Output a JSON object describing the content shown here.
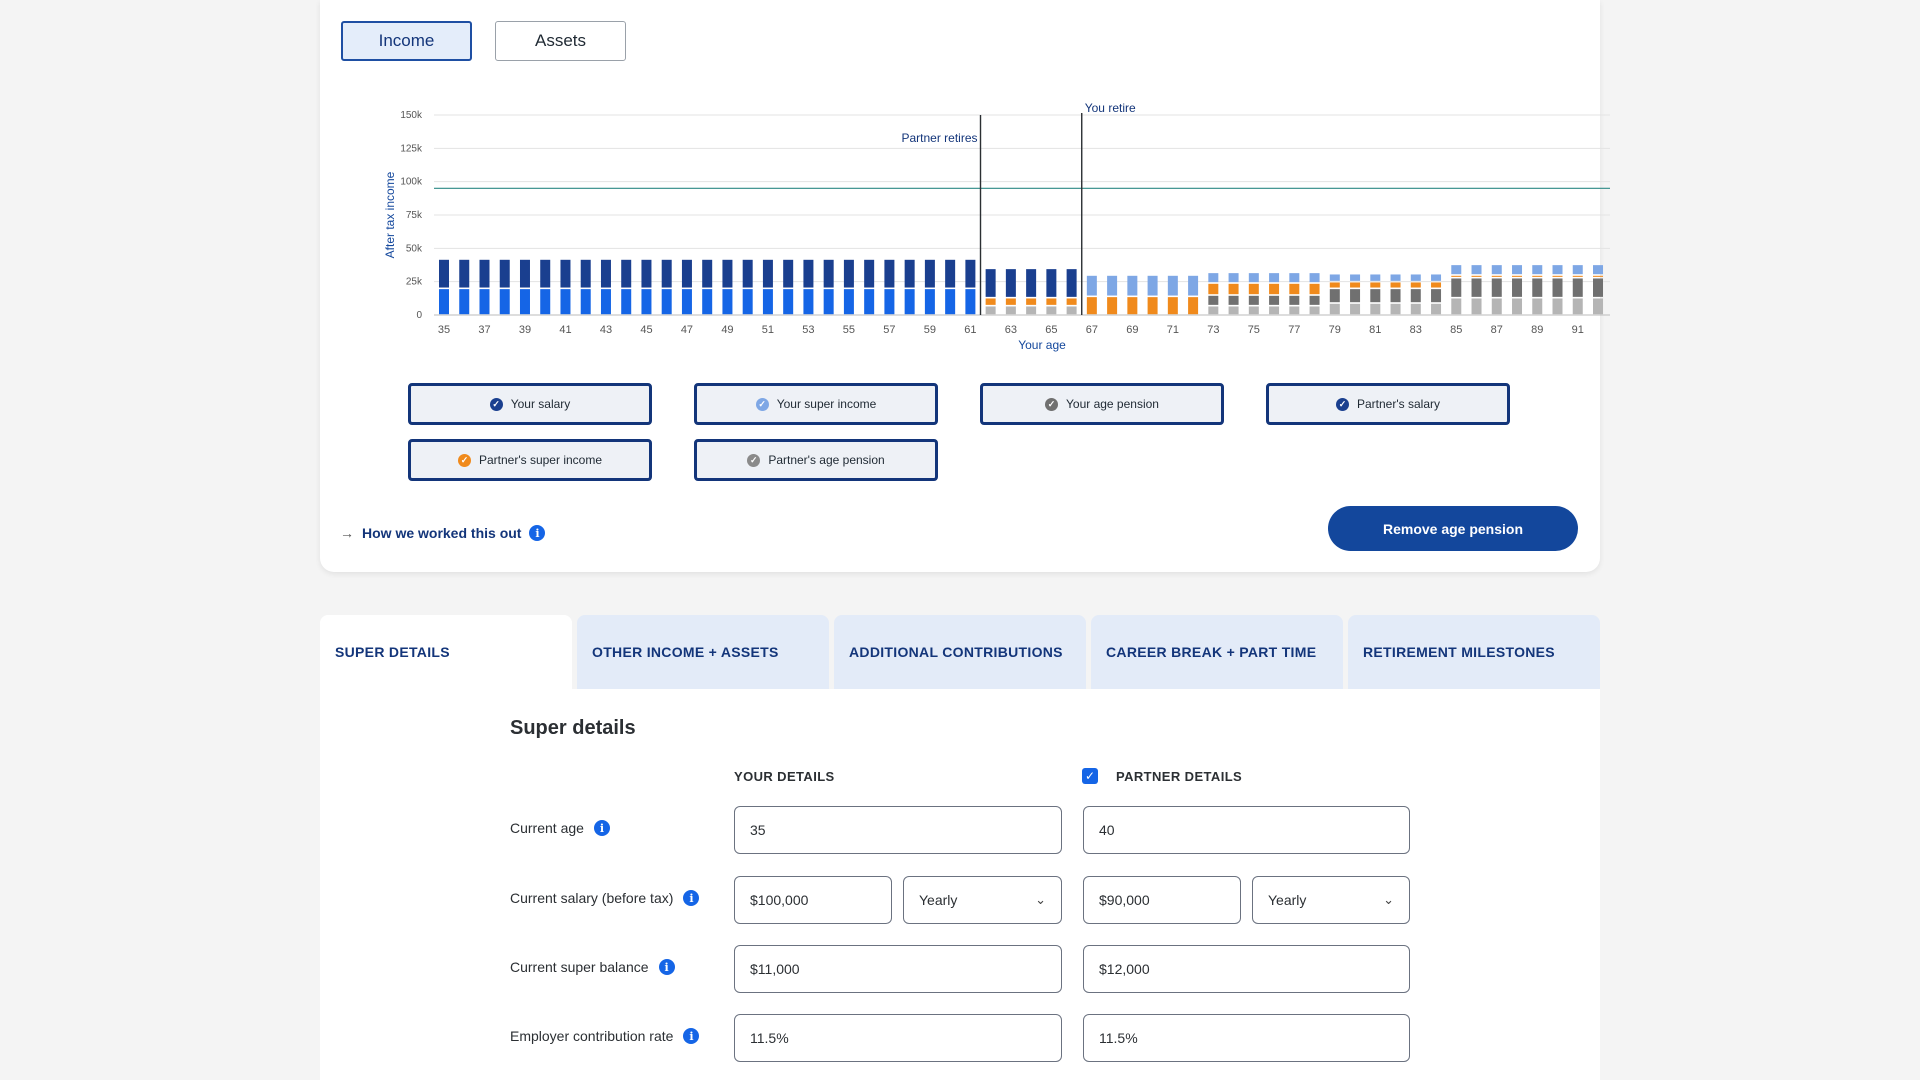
{
  "view_toggle": {
    "income_label": "Income",
    "assets_label": "Assets",
    "active": "income"
  },
  "chart_data": {
    "type": "bar",
    "stacked": true,
    "ylabel": "After tax income",
    "xlabel": "Your age",
    "yticks": [
      "0",
      "25k",
      "50k",
      "75k",
      "100k",
      "125k",
      "150k"
    ],
    "ylim": [
      0,
      150000
    ],
    "x_tick_labels": [
      "35",
      "37",
      "39",
      "41",
      "43",
      "45",
      "47",
      "49",
      "51",
      "53",
      "55",
      "57",
      "59",
      "61",
      "63",
      "65",
      "67",
      "69",
      "71",
      "73",
      "75",
      "77",
      "79",
      "81",
      "83",
      "85",
      "87",
      "89",
      "91"
    ],
    "reference_line_value": 95000,
    "markers": [
      {
        "label": "Partner retires",
        "age": 62
      },
      {
        "label": "You retire",
        "age": 67
      }
    ],
    "colors": {
      "your_salary": "#1a3f8f",
      "partner_salary": "#1565e6",
      "your_super_income": "#7ea7e5",
      "partner_super_income": "#f08a1c",
      "your_age_pension": "#707070",
      "partner_age_pension": "#b5b5b5",
      "reference_line": "#2d8a86"
    },
    "segments": [
      {
        "from_age": 35,
        "to_age": 61,
        "values": {
          "partner_salary": 20000,
          "your_salary": 22000
        }
      },
      {
        "from_age": 62,
        "to_age": 66,
        "values": {
          "partner_age_pension": 7000,
          "partner_super_income": 6000,
          "your_salary": 22000
        }
      },
      {
        "from_age": 67,
        "to_age": 67,
        "values": {
          "partner_super_income": 14000,
          "your_super_income": 16000
        }
      },
      {
        "from_age": 68,
        "to_age": 72,
        "values": {
          "partner_super_income": 14000,
          "your_super_income": 16000
        }
      },
      {
        "from_age": 73,
        "to_age": 78,
        "values": {
          "partner_age_pension": 7000,
          "partner_super_income": 9000,
          "your_age_pension": 8000,
          "your_super_income": 8000
        }
      },
      {
        "from_age": 79,
        "to_age": 84,
        "values": {
          "partner_age_pension": 9000,
          "partner_super_income": 5000,
          "your_age_pension": 11000,
          "your_super_income": 6000
        }
      },
      {
        "from_age": 85,
        "to_age": 92,
        "values": {
          "partner_age_pension": 13000,
          "partner_super_income": 2000,
          "your_age_pension": 15000,
          "your_super_income": 8000
        }
      }
    ]
  },
  "legend": [
    {
      "label": "Your salary",
      "color": "#1a3f8f"
    },
    {
      "label": "Your super income",
      "color": "#7ea7e5"
    },
    {
      "label": "Your age pension",
      "color": "#707070"
    },
    {
      "label": "Partner's salary",
      "color": "#1a3f8f"
    },
    {
      "label": "Partner's super income",
      "color": "#f08a1c"
    },
    {
      "label": "Partner's age pension",
      "color": "#8a8a8a"
    }
  ],
  "how_link": "How we worked this out",
  "remove_button": "Remove age pension",
  "tabs": [
    "SUPER DETAILS",
    "OTHER INCOME + ASSETS",
    "ADDITIONAL CONTRIBUTIONS",
    "CAREER BREAK + PART TIME",
    "RETIREMENT MILESTONES"
  ],
  "form": {
    "title": "Super details",
    "your_details": "YOUR DETAILS",
    "partner_details": "PARTNER DETAILS",
    "rows": {
      "age_label": "Current age",
      "salary_label": "Current salary (before tax)",
      "balance_label": "Current super balance",
      "rate_label": "Employer contribution rate"
    },
    "you": {
      "age": "35",
      "salary": "$100,000",
      "salary_freq": "Yearly",
      "balance": "$11,000",
      "rate": "11.5%"
    },
    "partner": {
      "age": "40",
      "salary": "$90,000",
      "salary_freq": "Yearly",
      "balance": "$12,000",
      "rate": "11.5%"
    }
  }
}
